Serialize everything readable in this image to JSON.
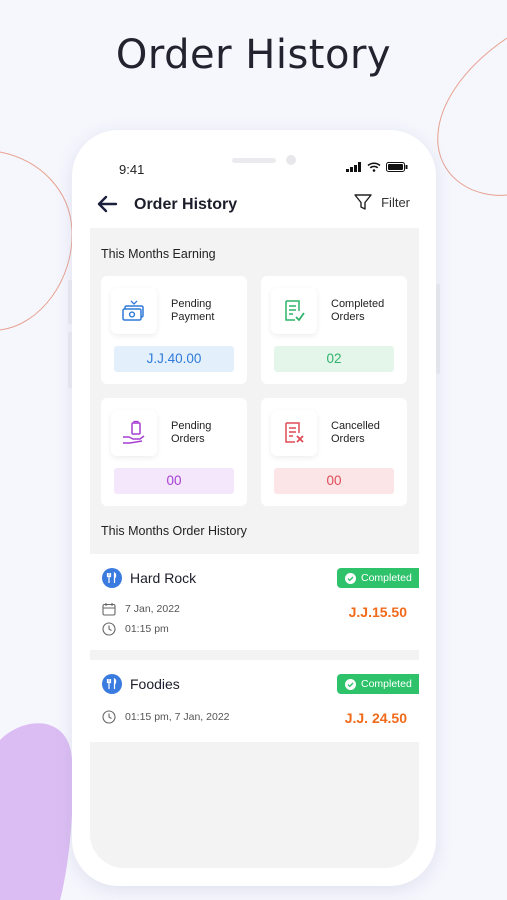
{
  "page_heading": "Order History",
  "status_bar": {
    "time": "9:41"
  },
  "header": {
    "title": "Order History",
    "filter_label": "Filter"
  },
  "earnings_section": {
    "label": "This Months Earning"
  },
  "stats": [
    {
      "title": "Pending Payment",
      "value": "J.J.40.00",
      "icon": "cash-icon"
    },
    {
      "title": "Completed Orders",
      "value": "02",
      "icon": "checklist-icon"
    },
    {
      "title": "Pending Orders",
      "value": "00",
      "icon": "hand-bag-icon"
    },
    {
      "title": "Cancelled Orders",
      "value": "00",
      "icon": "cancelled-doc-icon"
    }
  ],
  "history_section": {
    "label": "This Months Order History"
  },
  "orders": [
    {
      "restaurant": "Hard Rock",
      "status": "Completed",
      "date": "7 Jan, 2022",
      "time": "01:15 pm",
      "price": "J.J.15.50"
    },
    {
      "restaurant": "Foodies",
      "status": "Completed",
      "datetime": "01:15 pm, 7 Jan, 2022",
      "price": "J.J. 24.50"
    }
  ],
  "colors": {
    "accent_blue": "#2f7ad8",
    "completed_green": "#2ec26a",
    "price_orange": "#f06a19",
    "pending_purple": "#a63fd1",
    "cancel_red": "#e04b56"
  }
}
